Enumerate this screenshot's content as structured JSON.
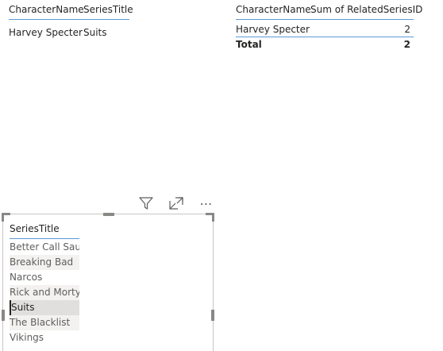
{
  "table1": {
    "headers": [
      "CharacterName",
      "SeriesTitle"
    ],
    "row": [
      "Harvey Specter",
      "Suits"
    ]
  },
  "table2": {
    "headers": [
      "CharacterName",
      "Sum of RelatedSeriesID"
    ],
    "row": [
      "Harvey Specter",
      "2"
    ],
    "total": [
      "Total",
      "2"
    ]
  },
  "toolbar": {
    "icons": [
      "filter-icon",
      "focus-mode-icon",
      "more-options-icon"
    ],
    "more_glyph": "⋯"
  },
  "slicer": {
    "title": "SeriesTitle",
    "items": [
      "Better Call Saul",
      "Breaking Bad",
      "Narcos",
      "Rick and Morty",
      "Suits",
      "The Blacklist",
      "Vikings"
    ],
    "selected": "Suits"
  },
  "colors": {
    "accent_border": "#5b9bd5",
    "text": "#252423",
    "muted_text": "#605e5c"
  }
}
